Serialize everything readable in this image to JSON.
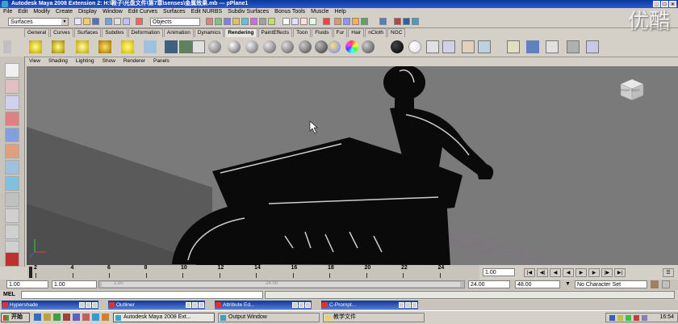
{
  "window": {
    "title": "Autodesk Maya 2008 Extension 2: H:\\鞍子\\光盘文件\\第7章\\senses\\金属效果.mb    ---    pPlane1",
    "watermark": "优酷"
  },
  "menubar": [
    "File",
    "Edit",
    "Modify",
    "Create",
    "Display",
    "Window",
    "Edit Curves",
    "Surfaces",
    "Edit NURBS",
    "Subdiv Surfaces",
    "Bonus Tools",
    "Muscle",
    "Help"
  ],
  "statusline": {
    "menuset": "Surfaces",
    "selection_mode": "Objects"
  },
  "shelf_tabs": [
    "General",
    "Curves",
    "Surfaces",
    "Subdivs",
    "Deformation",
    "Animation",
    "Dynamics",
    "Rendering",
    "PaintEffects",
    "Toon",
    "Fluids",
    "Fur",
    "Hair",
    "nCloth",
    "NGC"
  ],
  "shelf_active_tab": "Rendering",
  "viewport": {
    "menu": [
      "View",
      "Shading",
      "Lighting",
      "Show",
      "Renderer",
      "Panels"
    ],
    "viewcube": "FRONT  RIGHT"
  },
  "timeslider": {
    "ticks": [
      "2",
      "4",
      "6",
      "8",
      "10",
      "12",
      "14",
      "16",
      "18",
      "20",
      "22",
      "24"
    ],
    "current_frame": "1.00"
  },
  "rangeslider": {
    "start_time": "1.00",
    "start_range": "1.00",
    "range_start_label": "1.00",
    "range_end_label": "24.00",
    "end_range": "24.00",
    "end_time": "48.00",
    "character_set": "No Character Set"
  },
  "mel": {
    "label": "MEL"
  },
  "minimized_windows": [
    {
      "title": "Hypershade"
    },
    {
      "title": "Outliner"
    },
    {
      "title": "Attribute Ed..."
    },
    {
      "title": "C-Prompt..."
    }
  ],
  "taskbar": {
    "start": "开始",
    "tasks": [
      "Autodesk Maya 2008 Ext...",
      "Output Window",
      "教学文件"
    ],
    "clock": "16:54"
  }
}
